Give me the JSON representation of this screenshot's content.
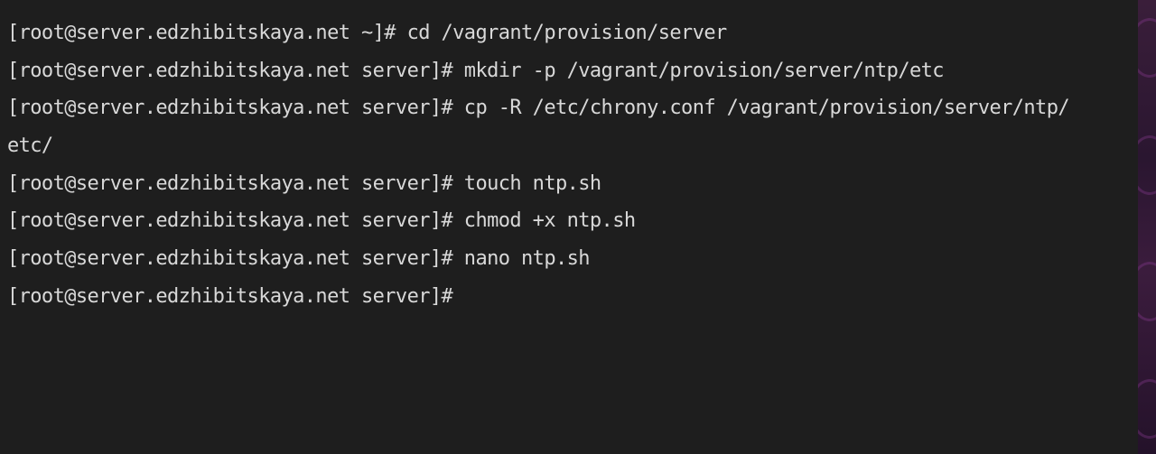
{
  "terminal": {
    "lines": [
      "[root@server.edzhibitskaya.net ~]# cd /vagrant/provision/server",
      "[root@server.edzhibitskaya.net server]# mkdir -p /vagrant/provision/server/ntp/etc",
      "[root@server.edzhibitskaya.net server]# cp -R /etc/chrony.conf /vagrant/provision/server/ntp/",
      "etc/",
      "[root@server.edzhibitskaya.net server]# touch ntp.sh",
      "[root@server.edzhibitskaya.net server]# chmod +x ntp.sh",
      "[root@server.edzhibitskaya.net server]# nano ntp.sh",
      "[root@server.edzhibitskaya.net server]# "
    ]
  },
  "colors": {
    "background": "#1e1e1e",
    "text": "#d8d8d8",
    "desktop_accent": "#3a1e3a"
  }
}
